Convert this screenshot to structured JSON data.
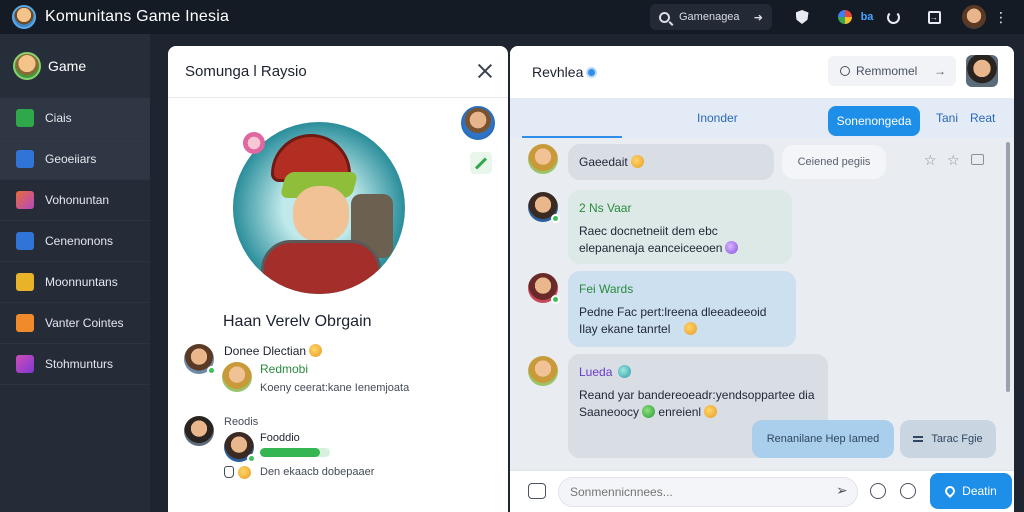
{
  "topbar": {
    "title": "Komunitans Game Inesia",
    "search_text": "Gamenagea",
    "badge_text": "ba"
  },
  "sidebar": {
    "header_label": "Game",
    "items": [
      {
        "label": "Ciais",
        "icon": "check-icon"
      },
      {
        "label": "Geoeiiars",
        "icon": "window-icon"
      },
      {
        "label": "Vohonuntan",
        "icon": "app-icon"
      },
      {
        "label": "Cenenonons",
        "icon": "check-icon"
      },
      {
        "label": "Moonnuntans",
        "icon": "badge-icon"
      },
      {
        "label": "Vanter Cointes",
        "icon": "star-icon"
      },
      {
        "label": "Stohmunturs",
        "icon": "puzzle-icon"
      }
    ]
  },
  "profile": {
    "title": "Somunga l Raysio",
    "name": "Haan Verelv Obrgain",
    "feed": [
      {
        "title": "Donee Dlectian",
        "sub": "Redmobi",
        "text": "Koeny ceerat:kane Ienemjoata"
      },
      {
        "title": "Reodis",
        "sub": "Fooddio",
        "progress": 0.85,
        "text": "Den ekaacb dobepaaer"
      }
    ]
  },
  "chat": {
    "title": "Revhlea",
    "search_text": "Remmomel",
    "tabs": [
      "Inonder",
      "Sonenongeda",
      "Tani",
      "Reat"
    ],
    "messages": [
      {
        "text": "Gaeedait"
      },
      {
        "name": "2 Ns Vaar",
        "text": "Raec docnetneiit dem ebc elepanenaja eanceiceeoen"
      },
      {
        "name": "Fei Wards",
        "text": "Pedne Fac pert:lreena dleeadeeoid",
        "text2": "Ilay ekane tanrtel"
      },
      {
        "name": "Lueda",
        "text": "Reand yar bandereoeadr:yendsoppartee dia",
        "text2": "Saaneoocy",
        "text3": "enreienl"
      }
    ],
    "reply_chip": "Ceiened pegiis",
    "actions": {
      "primary": "Renanilane Hep Iamed",
      "secondary": "Tarac Fgie"
    },
    "composer_placeholder": "Sonmennicnnees...",
    "send_label": "Deatin"
  }
}
